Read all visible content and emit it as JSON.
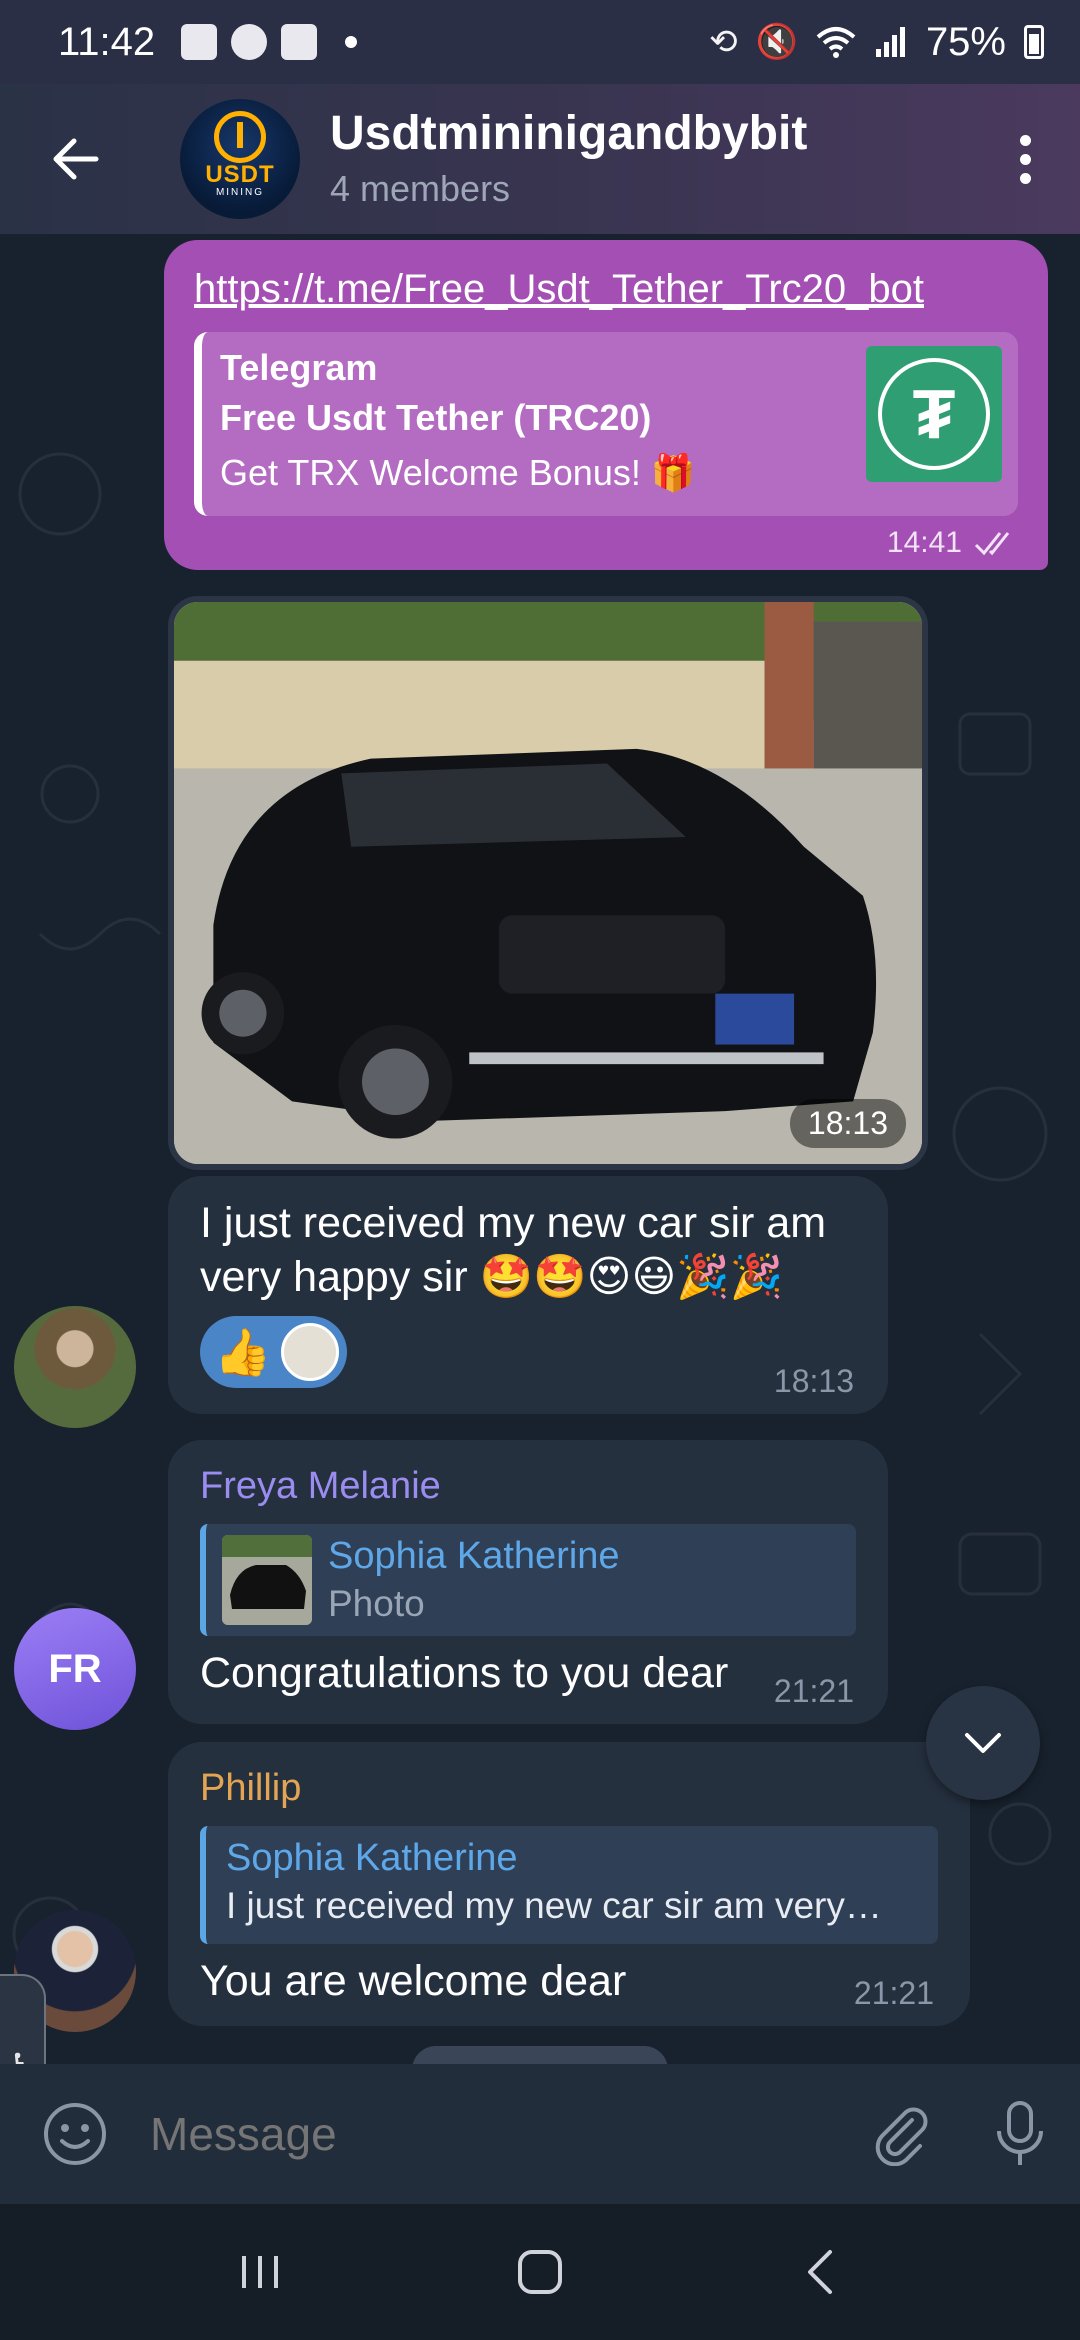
{
  "status_bar": {
    "time": "11:42",
    "battery": "75%"
  },
  "header": {
    "title": "Usdtmininigandbybit",
    "subtitle": "4 members",
    "avatar_text": "USDT",
    "avatar_subtext": "MINING"
  },
  "messages": {
    "link_message": {
      "url": "https://t.me/Free_Usdt_Tether_Trc20_bot",
      "preview_site": "Telegram",
      "preview_title": "Free Usdt Tether (TRC20)",
      "preview_description": "Get TRX Welcome Bonus! 🎁",
      "time": "14:41"
    },
    "photo_message": {
      "time": "18:13"
    },
    "text_message_1": {
      "text": "I just received my new car sir am very happy sir 🤩🤩😍😃🎉🎉",
      "reaction": "👍",
      "time": "18:13"
    },
    "reply_message_1": {
      "sender": "Freya Melanie",
      "sender_color": "#9b8cf0",
      "reply_to_name": "Sophia Katherine",
      "reply_to_snippet": "Photo",
      "text": "Congratulations to you dear",
      "time": "21:21",
      "avatar_initials": "FR"
    },
    "reply_message_2": {
      "sender": "Phillip",
      "sender_color": "#e3a553",
      "reply_to_name": "Sophia Katherine",
      "reply_to_snippet": "I just received my new car sir am very…",
      "text": "You are welcome dear",
      "time": "21:21"
    }
  },
  "input": {
    "placeholder": "Message"
  },
  "colors": {
    "outgoing_bubble": "#a34fb3",
    "incoming_bubble": "#25303f",
    "chat_background": "#18222e",
    "link_accent": "#5ea7e8"
  }
}
